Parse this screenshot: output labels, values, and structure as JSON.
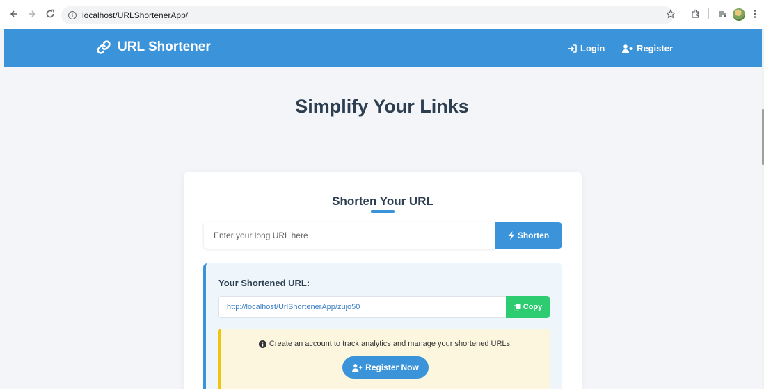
{
  "browser": {
    "url": "localhost/URLShortenerApp/",
    "back_icon": "arrow-left-icon",
    "forward_icon": "arrow-right-icon",
    "reload_icon": "reload-icon"
  },
  "header": {
    "brand": "URL Shortener",
    "login_label": "Login",
    "register_label": "Register",
    "accent_color": "#3b94d9"
  },
  "hero": {
    "title": "Simplify Your Links"
  },
  "card": {
    "title": "Shorten Your URL",
    "input_placeholder": "Enter your long URL here",
    "shorten_label": "Shorten"
  },
  "result": {
    "label": "Your Shortened URL:",
    "short_url": "http://localhost/UrlShortenerApp/zujo50",
    "copy_label": "Copy",
    "copy_color": "#2ecc71"
  },
  "notice": {
    "text": "Create an account to track analytics and manage your shortened URLs!",
    "register_now_label": "Register Now",
    "color": "#f1c40f"
  }
}
